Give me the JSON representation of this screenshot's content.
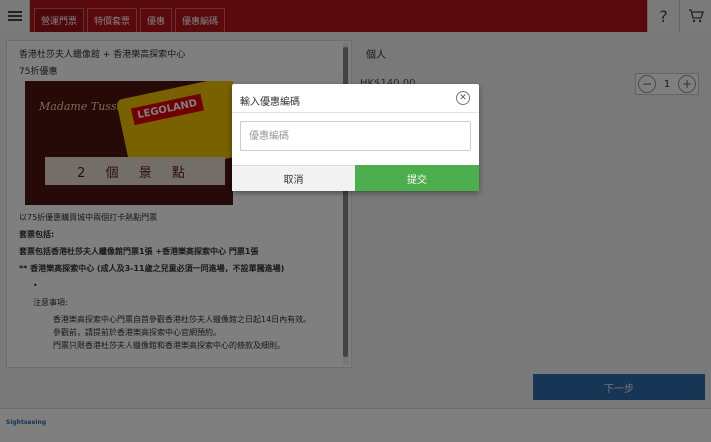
{
  "topbar": {
    "tabs": [
      "營運門票",
      "特價套票",
      "優惠",
      "優惠編碼"
    ],
    "help_icon": "?",
    "cart_icon": "cart-icon"
  },
  "product": {
    "title": "香港杜莎夫人蠟像館 + 香港樂高探索中心",
    "discount": "75折優惠",
    "image_text": {
      "madame": "Madame Tussauds",
      "legoland": "LEGOLAND",
      "banner": "2 個 景 點"
    },
    "desc_intro": "以75折優惠購買城中兩個打卡熱點門票",
    "includes_label": "套票包括:",
    "includes_item": "套票包括香港杜莎夫人蠟像館門票1張 +香港樂高探索中心 門票1張",
    "lego_note": "** 香港樂高探索中心 (成人及3-11歲之兒童必須一同進場，不設單獨進場)",
    "notes_label": "注意事項:",
    "notes": [
      "香港樂高探索中心門票自首參觀香港杜莎夫人蠟像館之日起14日內有效。",
      "參觀前，請提前於香港樂高探索中心官網預約。",
      "門票只限香港杜莎夫人蠟像館和香港樂高探索中心的條款及細則。"
    ]
  },
  "right": {
    "adult_label": "個人",
    "price": "HK$140.00",
    "qty_value": "1",
    "next_button": "下一步"
  },
  "footer": {
    "logo": "Sightseeing"
  },
  "modal": {
    "title": "輸入優惠編碼",
    "input_placeholder": "優惠編碼",
    "input_value": "",
    "cancel_label": "取消",
    "submit_label": "提交",
    "accent_color": "#4cae4c"
  }
}
